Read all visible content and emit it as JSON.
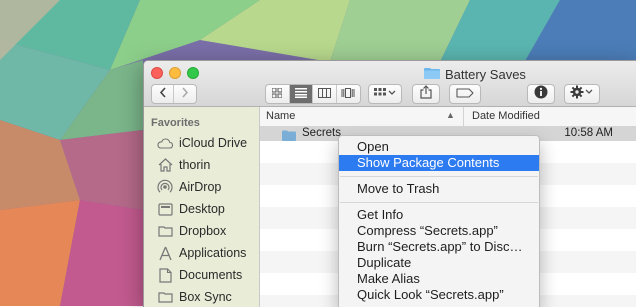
{
  "window": {
    "title": "Battery Saves",
    "title_icon": "folder-icon"
  },
  "toolbar": {
    "back": "chevron-left-icon",
    "forward": "chevron-right-icon",
    "views": [
      "icon-view-icon",
      "list-view-icon",
      "column-view-icon",
      "coverflow-view-icon"
    ],
    "active_view": "list-view-icon",
    "arrange": "arrange-grid-icon",
    "share": "share-icon",
    "tags": "tag-icon",
    "info": "info-icon",
    "action": "gear-icon"
  },
  "sidebar": {
    "heading": "Favorites",
    "items": [
      {
        "label": "iCloud Drive",
        "icon": "cloud-icon"
      },
      {
        "label": "thorin",
        "icon": "home-icon"
      },
      {
        "label": "AirDrop",
        "icon": "airdrop-icon"
      },
      {
        "label": "Desktop",
        "icon": "desktop-icon"
      },
      {
        "label": "Dropbox",
        "icon": "dropbox-folder-icon"
      },
      {
        "label": "Applications",
        "icon": "applications-icon"
      },
      {
        "label": "Documents",
        "icon": "documents-icon"
      },
      {
        "label": "Box Sync",
        "icon": "box-sync-icon"
      }
    ]
  },
  "list": {
    "columns": {
      "name": "Name",
      "date": "Date Modified"
    },
    "rows": [
      {
        "name": "Secrets",
        "date": "10:58 AM"
      }
    ]
  },
  "context_menu": {
    "items": [
      "Open",
      "Show Package Contents",
      "Move to Trash",
      "Get Info",
      "Compress “Secrets.app”",
      "Burn “Secrets.app” to Disc…",
      "Duplicate",
      "Make Alias",
      "Quick Look “Secrets.app”"
    ],
    "highlighted": "Show Package Contents"
  },
  "colors": {
    "highlight": "#2d7bf0",
    "sidebar_bg": "#e8ecd6",
    "selected_row": "#d5d5d5"
  }
}
